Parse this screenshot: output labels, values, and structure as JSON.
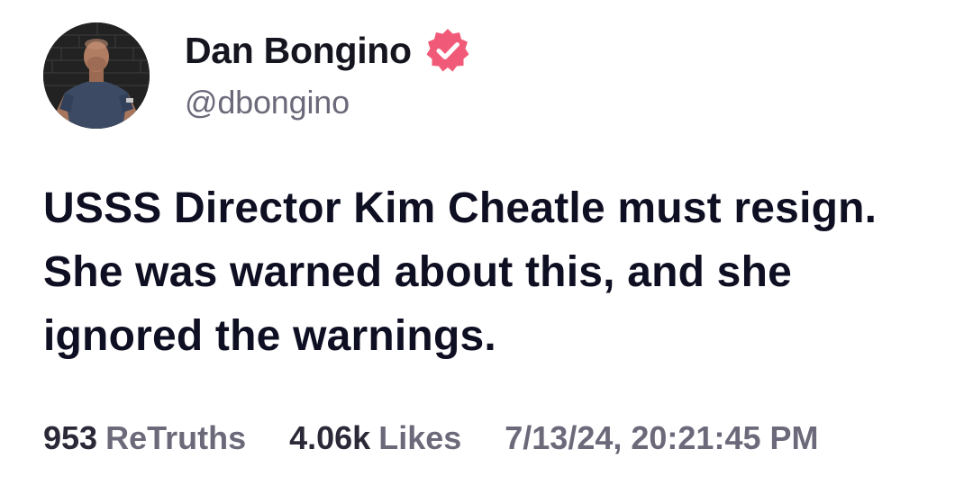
{
  "author": {
    "display_name": "Dan Bongino",
    "handle": "@dbongino",
    "verified": true,
    "verified_color": "#f05a78",
    "avatar_icon": "profile-photo"
  },
  "post": {
    "text": "USSS Director Kim Cheatle must resign. She was warned about this, and she ignored the warnings."
  },
  "stats": {
    "retruths_count": "953",
    "retruths_label": "ReTruths",
    "likes_count": "4.06k",
    "likes_label": "Likes",
    "timestamp": "7/13/24, 20:21:45 PM"
  }
}
